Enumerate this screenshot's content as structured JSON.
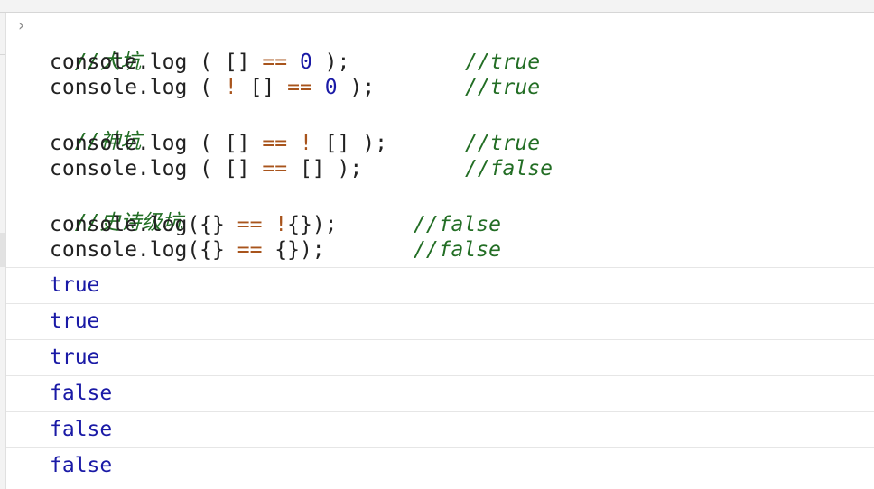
{
  "input": {
    "lines": [
      {
        "segments": [
          {
            "t": "//大坑",
            "c": "comment"
          }
        ]
      },
      {
        "segments": [
          {
            "t": "console.log ( [] ",
            "c": "plain"
          },
          {
            "t": "==",
            "c": "op"
          },
          {
            "t": " ",
            "c": "plain"
          },
          {
            "t": "0",
            "c": "num"
          },
          {
            "t": " );",
            "c": "plain"
          }
        ],
        "comment": "//true"
      },
      {
        "segments": [
          {
            "t": "console.log ( ",
            "c": "plain"
          },
          {
            "t": "!",
            "c": "op"
          },
          {
            "t": " [] ",
            "c": "plain"
          },
          {
            "t": "==",
            "c": "op"
          },
          {
            "t": " ",
            "c": "plain"
          },
          {
            "t": "0",
            "c": "num"
          },
          {
            "t": " );",
            "c": "plain"
          }
        ],
        "comment": "//true"
      },
      {
        "segments": [
          {
            "t": "//神坑",
            "c": "comment"
          }
        ]
      },
      {
        "segments": [
          {
            "t": "console.log ( [] ",
            "c": "plain"
          },
          {
            "t": "==",
            "c": "op"
          },
          {
            "t": " ",
            "c": "plain"
          },
          {
            "t": "!",
            "c": "op"
          },
          {
            "t": " [] );",
            "c": "plain"
          }
        ],
        "comment": "//true"
      },
      {
        "segments": [
          {
            "t": "console.log ( [] ",
            "c": "plain"
          },
          {
            "t": "==",
            "c": "op"
          },
          {
            "t": " [] );",
            "c": "plain"
          }
        ],
        "comment": "//false"
      },
      {
        "segments": [
          {
            "t": "//史诗级坑",
            "c": "comment"
          }
        ]
      },
      {
        "segments": [
          {
            "t": "console.log({} ",
            "c": "plain"
          },
          {
            "t": "==",
            "c": "op"
          },
          {
            "t": " ",
            "c": "plain"
          },
          {
            "t": "!",
            "c": "op"
          },
          {
            "t": "{});",
            "c": "plain"
          }
        ],
        "comment": "//false"
      },
      {
        "segments": [
          {
            "t": "console.log({} ",
            "c": "plain"
          },
          {
            "t": "==",
            "c": "op"
          },
          {
            "t": " {});",
            "c": "plain"
          }
        ],
        "comment": "//false"
      }
    ]
  },
  "results": [
    "true",
    "true",
    "true",
    "false",
    "false",
    "false"
  ],
  "colors": {
    "comment": "#236e25",
    "operator": "#a8541c",
    "number": "#1a1aa6",
    "result": "#1a1aa6",
    "text": "#222222"
  },
  "icons": {
    "prompt": "chevron-right-icon"
  }
}
